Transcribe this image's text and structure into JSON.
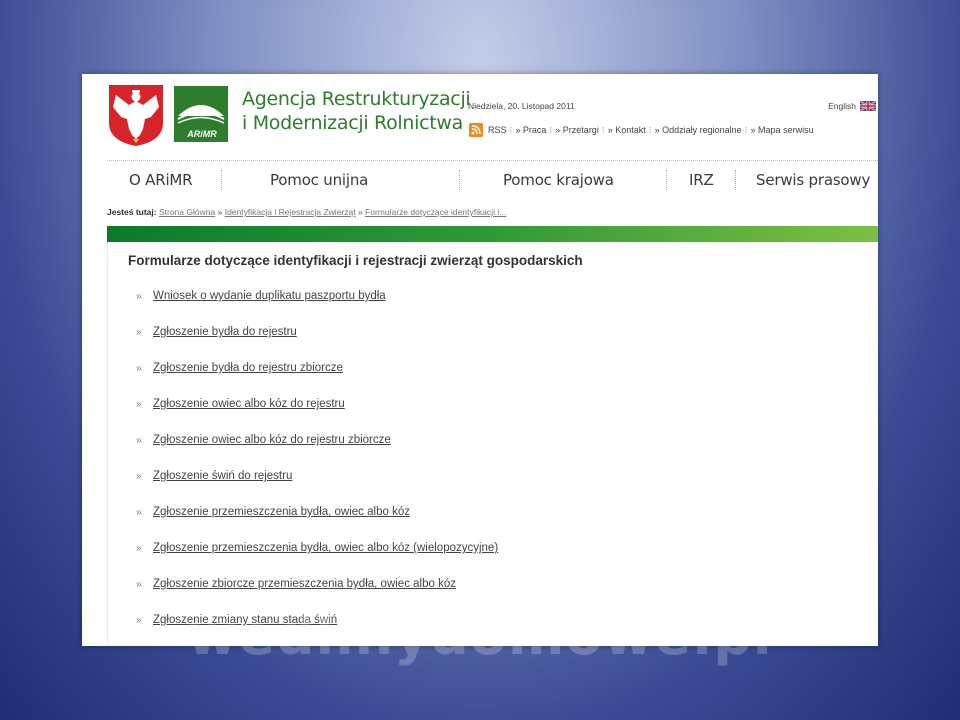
{
  "header": {
    "agency_line1": "Agencja Restrukturyzacji",
    "agency_line2": "i Modernizacji Rolnictwa",
    "logo_text": "ARiMR",
    "date": "Niedziela, 20. Listopad 2011",
    "language": "English",
    "top_links": [
      "RSS",
      "» Praca",
      "» Przetargi",
      "» Kontakt",
      "» Oddziały regionalne",
      "» Mapa serwisu"
    ]
  },
  "nav": {
    "items": [
      "O ARiMR",
      "Pomoc unijna",
      "Pomoc krajowa",
      "IRZ",
      "Serwis prasowy"
    ]
  },
  "breadcrumb": {
    "label": "Jesteś tutaj:",
    "items": [
      "Strona Główna",
      "Identyfikacja i Rejestracja Zwierząt",
      "Formularze dotyczące identyfikacji i..."
    ]
  },
  "content": {
    "title": "Formularze dotyczące identyfikacji i rejestracji zwierząt gospodarskich",
    "links": [
      "Wniosek o wydanie duplikatu paszportu bydła",
      "Zgłoszenie bydła do rejestru",
      "Zgłoszenie bydła do rejestru zbiorcze",
      "Zgłoszenie owiec albo kóz do rejestru",
      "Zgłoszenie owiec albo kóz do rejestru zbiorcze",
      "Zgłoszenie świń do rejestru",
      "Zgłoszenie przemieszczenia bydła, owiec albo kóz",
      "Zgłoszenie przemieszczenia bydła, owiec albo kóz (wielopozycyjne)",
      "Zgłoszenie zbiorcze przemieszczenia bydła, owiec albo kóz",
      "Zgłoszenie zmiany stanu stada świń"
    ]
  },
  "watermark": "wedlinydomowe.pl",
  "colors": {
    "brand_green": "#2e7d2c",
    "rss_orange": "#f08a24",
    "emblem_red": "#d8232a",
    "slide_bg": "#2f3f88"
  }
}
